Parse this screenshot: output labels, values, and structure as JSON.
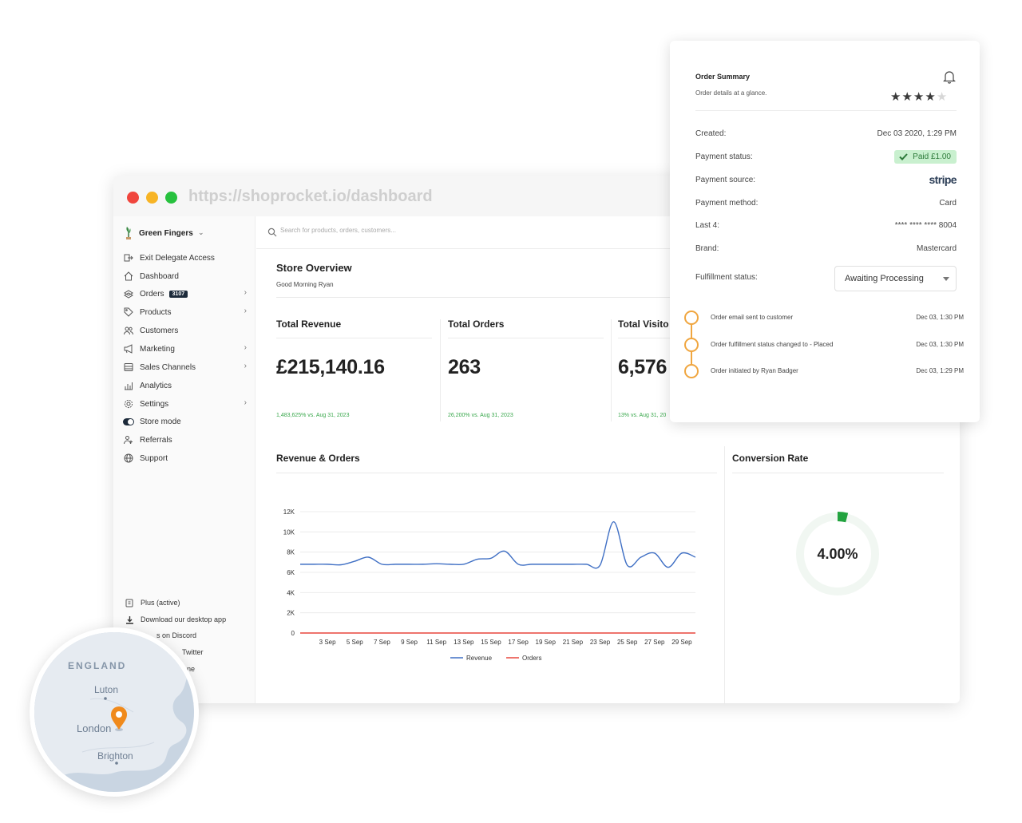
{
  "browser": {
    "url": "https://shoprocket.io/dashboard"
  },
  "sidebar": {
    "store_name": "Green Fingers",
    "items": [
      {
        "label": "Exit Delegate Access",
        "icon": "exit-icon"
      },
      {
        "label": "Dashboard",
        "icon": "home-icon"
      },
      {
        "label": "Orders",
        "icon": "orders-icon",
        "badge": "3107"
      },
      {
        "label": "Products",
        "icon": "tag-icon"
      },
      {
        "label": "Customers",
        "icon": "users-icon"
      },
      {
        "label": "Marketing",
        "icon": "megaphone-icon"
      },
      {
        "label": "Sales Channels",
        "icon": "channels-icon"
      },
      {
        "label": "Analytics",
        "icon": "analytics-icon"
      },
      {
        "label": "Settings",
        "icon": "gear-icon"
      },
      {
        "label": "Store mode",
        "icon": "toggle-icon"
      },
      {
        "label": "Referrals",
        "icon": "referral-icon"
      },
      {
        "label": "Support",
        "icon": "globe-icon"
      }
    ],
    "bottom": [
      {
        "label": "Plus (active)",
        "icon": "plus-plan-icon"
      },
      {
        "label": "Download our desktop app",
        "icon": "download-icon"
      },
      {
        "label": "s on Discord",
        "icon": "discord-icon"
      },
      {
        "label": "Twitter",
        "icon": "twitter-icon"
      },
      {
        "label": "ne",
        "icon": "theme-icon"
      }
    ]
  },
  "search": {
    "placeholder": "Search for products, orders, customers..."
  },
  "overview": {
    "title": "Store Overview",
    "greeting": "Good Morning Ryan"
  },
  "stats": [
    {
      "title": "Total Revenue",
      "value": "£215,140.16",
      "change": "1,483,625% vs. Aug 31, 2023"
    },
    {
      "title": "Total Orders",
      "value": "263",
      "change": "26,200% vs. Aug 31, 2023"
    },
    {
      "title": "Total Visito",
      "value": "6,576",
      "change": "13% vs. Aug 31, 20"
    }
  ],
  "revenue_section": {
    "title": "Revenue & Orders"
  },
  "conversion": {
    "title": "Conversion Rate",
    "value": "4.00%",
    "fraction": 0.04,
    "track_color": "#f1f7f2",
    "fill_color": "#22a33f"
  },
  "chart_data": {
    "type": "line",
    "categories": [
      "3 Sep",
      "5 Sep",
      "7 Sep",
      "9 Sep",
      "11 Sep",
      "13 Sep",
      "15 Sep",
      "17 Sep",
      "19 Sep",
      "21 Sep",
      "23 Sep",
      "25 Sep",
      "27 Sep",
      "29 Sep"
    ],
    "x": [
      1,
      2,
      3,
      4,
      5,
      6,
      7,
      8,
      9,
      10,
      11,
      12,
      13,
      14,
      15,
      16,
      17,
      18,
      19,
      20,
      21,
      22,
      23,
      24,
      25,
      26,
      27,
      28,
      29,
      30
    ],
    "series": [
      {
        "name": "Revenue",
        "color": "#3f6fc4",
        "values": [
          6800,
          6800,
          6800,
          6750,
          7100,
          7500,
          6800,
          6800,
          6800,
          6800,
          6850,
          6800,
          6800,
          7300,
          7400,
          8100,
          6800,
          6800,
          6800,
          6800,
          6800,
          6800,
          6700,
          11000,
          6700,
          7500,
          7900,
          6500,
          7900,
          7500
        ]
      },
      {
        "name": "Orders",
        "color": "#e8473d",
        "values": [
          0,
          0,
          0,
          0,
          0,
          0,
          0,
          0,
          0,
          0,
          0,
          0,
          0,
          0,
          0,
          0,
          0,
          0,
          0,
          0,
          0,
          0,
          0,
          0,
          0,
          0,
          0,
          0,
          0,
          0
        ]
      }
    ],
    "y_ticks": [
      "0",
      "2K",
      "4K",
      "6K",
      "8K",
      "10K",
      "12K"
    ],
    "ylim": [
      0,
      12000
    ],
    "legend_position": "bottom",
    "grid": true
  },
  "order_summary": {
    "title": "Order Summary",
    "subtitle": "Order details at a glance.",
    "rating": 4,
    "rating_max": 5,
    "rows": [
      {
        "label": "Created:",
        "value": "Dec 03 2020, 1:29 PM"
      },
      {
        "label": "Payment status:",
        "value": "Paid £1.00"
      },
      {
        "label": "Payment source:",
        "value": "stripe"
      },
      {
        "label": "Payment method:",
        "value": "Card"
      },
      {
        "label": "Last 4:",
        "value": "**** **** **** 8004"
      },
      {
        "label": "Brand:",
        "value": "Mastercard"
      },
      {
        "label": "Fulfillment status:",
        "value": "Awaiting Processing"
      }
    ],
    "timeline": [
      {
        "text": "Order email sent to customer",
        "date": "Dec 03, 1:30 PM"
      },
      {
        "text": "Order fulfillment status changed to - Placed",
        "date": "Dec 03, 1:30 PM"
      },
      {
        "text": "Order initiated by Ryan Badger",
        "date": "Dec 03, 1:29 PM"
      }
    ]
  },
  "map": {
    "region": "ENGLAND",
    "cities": [
      "Luton",
      "London",
      "Brighton"
    ],
    "pin_color": "#f08a1c"
  }
}
